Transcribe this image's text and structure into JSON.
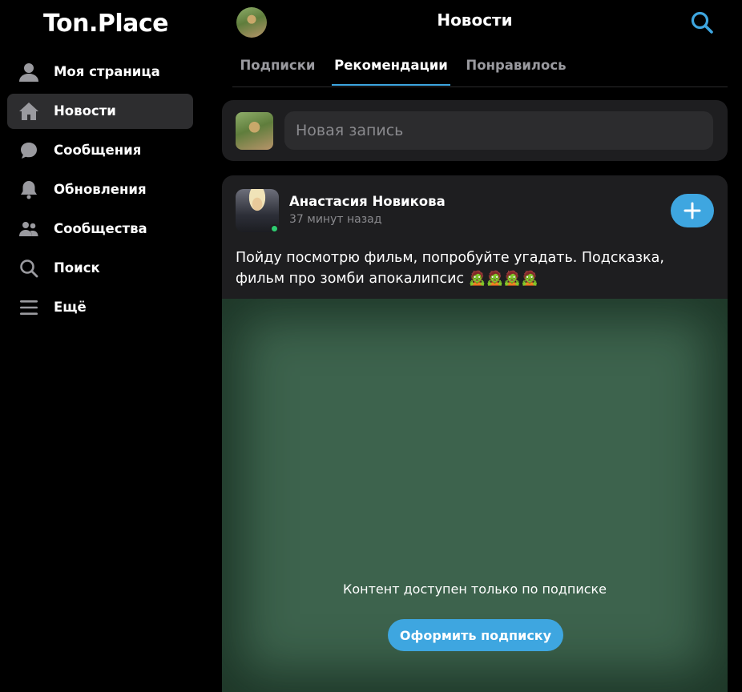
{
  "app": {
    "logo": "Ton.Place"
  },
  "sidebar": {
    "items": [
      {
        "label": "Моя страница",
        "icon": "user-icon",
        "active": false
      },
      {
        "label": "Новости",
        "icon": "home-icon",
        "active": true
      },
      {
        "label": "Сообщения",
        "icon": "chat-icon",
        "active": false
      },
      {
        "label": "Обновления",
        "icon": "bell-icon",
        "active": false
      },
      {
        "label": "Сообщества",
        "icon": "group-icon",
        "active": false
      },
      {
        "label": "Поиск",
        "icon": "search-icon",
        "active": false
      },
      {
        "label": "Ещё",
        "icon": "menu-icon",
        "active": false
      }
    ]
  },
  "header": {
    "title": "Новости",
    "search_icon": "search-icon"
  },
  "tabs": [
    {
      "label": "Подписки",
      "active": false
    },
    {
      "label": "Рекомендации",
      "active": true
    },
    {
      "label": "Понравилось",
      "active": false
    }
  ],
  "composer": {
    "placeholder": "Новая запись"
  },
  "post": {
    "author": "Анастасия Новикова",
    "time": "37 минут назад",
    "online": true,
    "text": "Пойду посмотрю фильм, попробуйте угадать. Подсказка, фильм про зомби апокалипсис 🧟🧟🧟🧟",
    "locked_message": "Контент доступен только по подписке",
    "subscribe_label": "Оформить подписку"
  },
  "colors": {
    "accent": "#3ea6e0",
    "background": "#000000",
    "card": "#1e1e20",
    "media": "#3d634d",
    "online": "#2ecc71"
  }
}
